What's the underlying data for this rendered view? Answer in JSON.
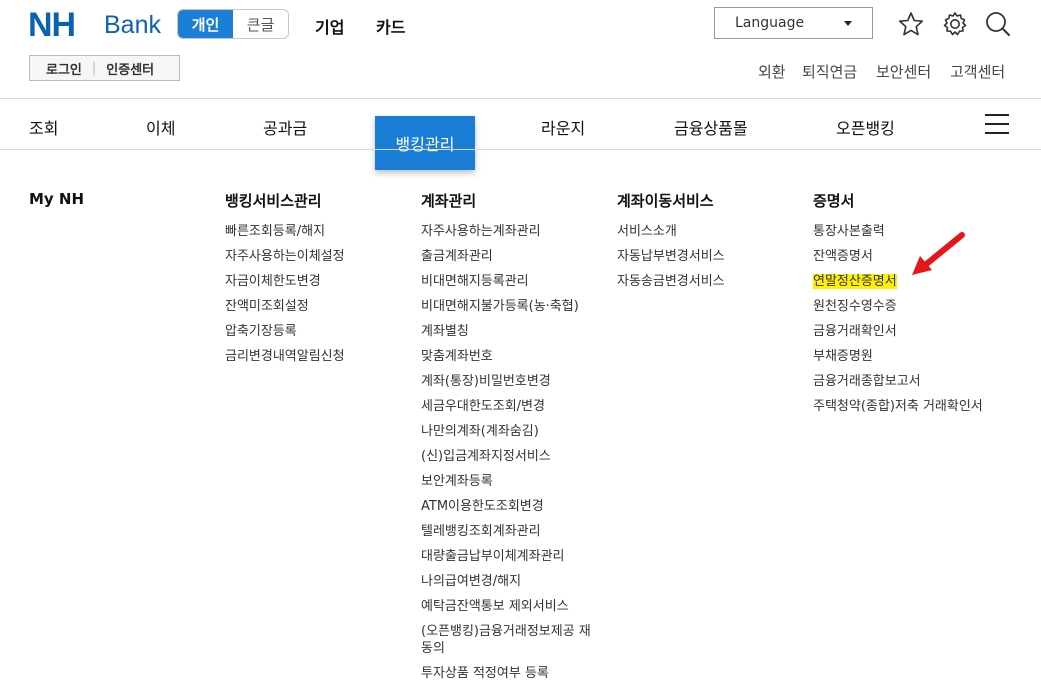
{
  "logo": {
    "nh": "NH",
    "bank": "Bank"
  },
  "segment": {
    "personal": "개인",
    "large_text": "큰글"
  },
  "top_menu": [
    "기업",
    "카드"
  ],
  "language": {
    "label": "Language"
  },
  "auth": {
    "login": "로그인",
    "cert_center": "인증센터"
  },
  "utility_links": [
    "외환",
    "퇴직연금",
    "보안센터",
    "고객센터"
  ],
  "gnb": {
    "items": [
      "조회",
      "이체",
      "공과금",
      "뱅킹관리",
      "라운지",
      "금융상품몰",
      "오픈뱅킹"
    ],
    "active": "뱅킹관리"
  },
  "mega": {
    "my_nh": "My NH",
    "banking_service": {
      "title": "뱅킹서비스관리",
      "items": [
        "빠른조회등록/해지",
        "자주사용하는이체설정",
        "자금이체한도변경",
        "잔액미조회설정",
        "압축기장등록",
        "금리변경내역알림신청"
      ]
    },
    "account": {
      "title": "계좌관리",
      "items": [
        "자주사용하는계좌관리",
        "출금계좌관리",
        "비대면해지등록관리",
        "비대면해지불가등록(농·축협)",
        "계좌별칭",
        "맞춤계좌번호",
        "계좌(통장)비밀번호변경",
        "세금우대한도조회/변경",
        "나만의계좌(계좌숨김)",
        "(신)입금계좌지정서비스",
        "보안계좌등록",
        "ATM이용한도조회변경",
        "텔레뱅킹조회계좌관리",
        "대량출금납부이체계좌관리",
        "나의급여변경/해지",
        "예탁금잔액통보 제외서비스",
        "(오픈뱅킹)금융거래정보제공 재동의",
        "투자상품 적정여부 등록"
      ]
    },
    "transfer": {
      "title": "계좌이동서비스",
      "items": [
        "서비스소개",
        "자동납부변경서비스",
        "자동송금변경서비스"
      ]
    },
    "certificate": {
      "title": "증명서",
      "items": [
        "통장사본출력",
        "잔액증명서",
        "연말정산증명서",
        "원천징수영수증",
        "금융거래확인서",
        "부채증명원",
        "금융거래종합보고서",
        "주택청약(종합)저축 거래확인서"
      ],
      "highlighted": "연말정산증명서"
    }
  },
  "colors": {
    "brand": "#0b62b0",
    "accent": "#1a7dd6",
    "highlight": "#fff200",
    "arrow": "#e8141c"
  },
  "icons": [
    "star-icon",
    "gear-icon",
    "search-icon",
    "menu-icon",
    "red-arrow-annotation"
  ]
}
